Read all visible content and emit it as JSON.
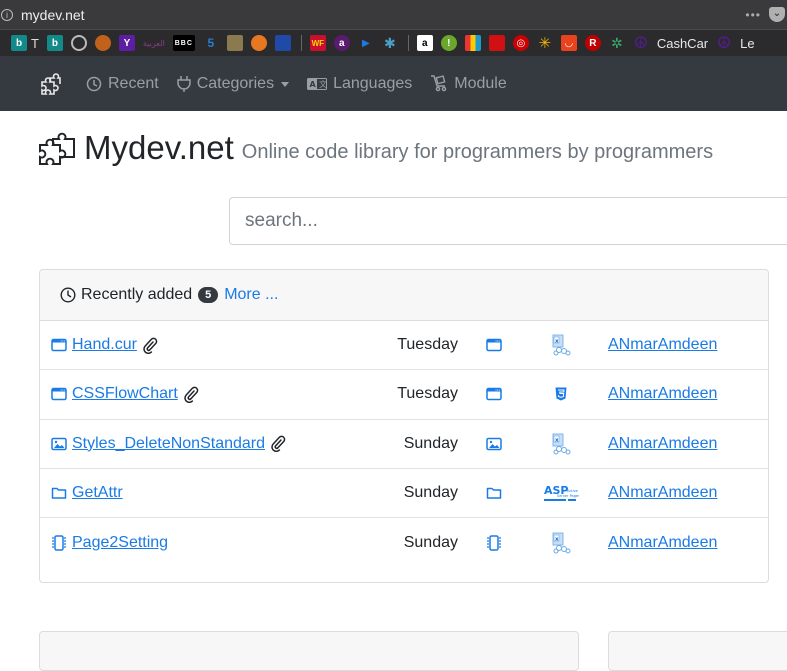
{
  "browser": {
    "url": "mydev.net",
    "menu_dots": "•••",
    "bookmarks": [
      {
        "icon": "bing-icon",
        "label": "b",
        "color": "#138a8a"
      },
      {
        "icon": "t-text-icon",
        "label": "T",
        "color": ""
      },
      {
        "icon": "bing-icon",
        "label": "b",
        "color": "#138a8a"
      },
      {
        "icon": "globe-icon",
        "label": "",
        "color": ""
      },
      {
        "icon": "swirl-icon",
        "label": "",
        "color": "#c0621c"
      },
      {
        "icon": "yahoo-icon",
        "label": "Y",
        "color": "#5c1ea3"
      },
      {
        "icon": "alarabiya-icon",
        "label": "العربية",
        "color": ""
      },
      {
        "icon": "bbc-icon",
        "label": "BBC",
        "color": "#000000"
      },
      {
        "icon": "nbc5-icon",
        "label": "5",
        "color": ""
      },
      {
        "icon": "stone-icon",
        "label": "",
        "color": "#8a7a50"
      },
      {
        "icon": "sun-icon",
        "label": "",
        "color": "#e87722"
      },
      {
        "icon": "weather-channel-icon",
        "label": "",
        "color": "#1f4aa8"
      },
      {
        "icon": "separator",
        "label": "",
        "color": ""
      },
      {
        "icon": "wells-fargo-icon",
        "label": "WF",
        "color": "#c8102e"
      },
      {
        "icon": "a-logo-icon",
        "label": "a",
        "color": "#5a1a6e"
      },
      {
        "icon": "play-icon",
        "label": "▶",
        "color": ""
      },
      {
        "icon": "snowflake-icon",
        "label": "✱",
        "color": ""
      },
      {
        "icon": "separator",
        "label": "",
        "color": ""
      },
      {
        "icon": "amazon-icon",
        "label": "a",
        "color": "#ffffff"
      },
      {
        "icon": "exclaim-icon",
        "label": "!",
        "color": "#6aa72a"
      },
      {
        "icon": "shopping-bag-icon",
        "label": "",
        "color": "#222222"
      },
      {
        "icon": "lego-icon",
        "label": "",
        "color": "#d01012"
      },
      {
        "icon": "target-icon",
        "label": "◎",
        "color": "#cc0000"
      },
      {
        "icon": "walmart-icon",
        "label": "✳",
        "color": ""
      },
      {
        "icon": "aliexpress-icon",
        "label": "◡",
        "color": "#e8421e"
      },
      {
        "icon": "rakuten-icon",
        "label": "R",
        "color": "#bf0000"
      },
      {
        "icon": "palm-icon",
        "label": "",
        "color": ""
      },
      {
        "icon": "peace-icon",
        "label": "☮",
        "color": ""
      },
      {
        "icon": "peace-icon",
        "label": "☮",
        "color": ""
      }
    ],
    "bookmark_label_cashcar": "CashCar",
    "bookmark_label_partial": "Le"
  },
  "navbar": {
    "items": [
      {
        "label": "Recent",
        "icon": "clock-icon"
      },
      {
        "label": "Categories",
        "icon": "plug-icon",
        "dropdown": true
      },
      {
        "label": "Languages",
        "icon": "language-icon"
      },
      {
        "label": "Module",
        "icon": "cart-icon"
      }
    ]
  },
  "header": {
    "title": "Mydev.net",
    "subtitle": "Online code library for programmers by programmers"
  },
  "search": {
    "placeholder": "search..."
  },
  "recent": {
    "title": "Recently added",
    "count": "5",
    "more_label": "More ...",
    "rows": [
      {
        "name": "Hand.cur",
        "type_icon": "window-icon",
        "attachment": true,
        "day": "Tuesday",
        "lang_icon": "vb-icon",
        "author": "ANmarAmdeen"
      },
      {
        "name": "CSSFlowChart",
        "type_icon": "window-icon",
        "attachment": true,
        "day": "Tuesday",
        "lang_icon": "html5-icon",
        "author": "ANmarAmdeen"
      },
      {
        "name": "Styles_DeleteNonStandard",
        "type_icon": "image-icon",
        "attachment": true,
        "day": "Sunday",
        "lang_icon": "vb-icon",
        "author": "ANmarAmdeen"
      },
      {
        "name": "GetAttr",
        "type_icon": "folder-icon",
        "attachment": false,
        "day": "Sunday",
        "lang_icon": "asp-icon",
        "author": "ANmarAmdeen"
      },
      {
        "name": "Page2Setting",
        "type_icon": "chip-icon",
        "attachment": false,
        "day": "Sunday",
        "lang_icon": "vb-icon",
        "author": "ANmarAmdeen"
      }
    ]
  },
  "colors": {
    "navbar_bg": "#343a40",
    "link": "#1a7be6",
    "badge_bg": "#343a40"
  }
}
